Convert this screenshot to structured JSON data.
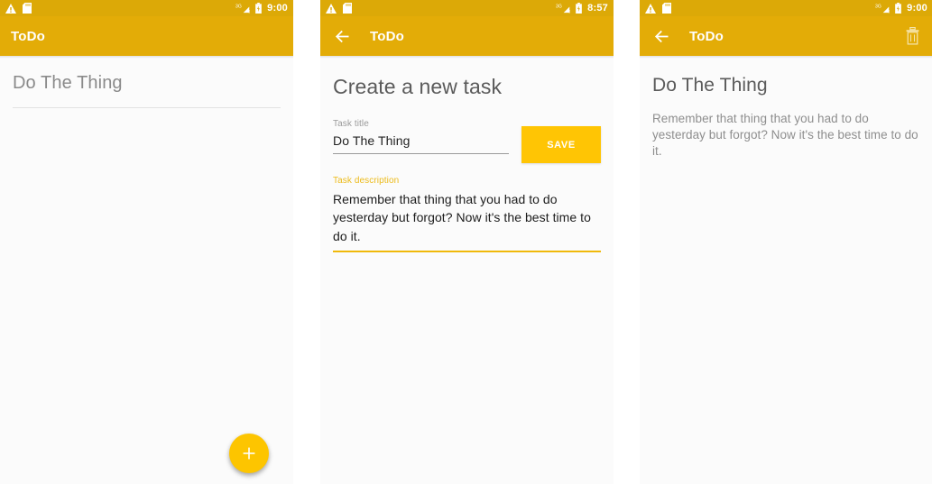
{
  "app": {
    "name": "ToDo",
    "colors": {
      "status_bar": "#dca907",
      "app_bar": "#e3ac07",
      "accent": "#ffc504",
      "fab": "#fdc500",
      "focused_label": "#ecbb1b"
    }
  },
  "screens": [
    {
      "id": "task-list",
      "status_bar": {
        "time": "9:00",
        "icons_left": [
          "warning-icon",
          "sd-card-icon"
        ],
        "icons_right": [
          "signal-3g-icon",
          "battery-icon"
        ]
      },
      "app_bar": {
        "title": "ToDo",
        "has_back": false,
        "has_delete": false
      },
      "list": {
        "items": [
          {
            "title": "Do The Thing"
          }
        ]
      },
      "fab": {
        "icon": "plus-icon",
        "label": "+"
      }
    },
    {
      "id": "create-task",
      "status_bar": {
        "time": "8:57",
        "icons_left": [
          "warning-icon",
          "sd-card-icon"
        ],
        "icons_right": [
          "signal-3g-icon",
          "battery-icon"
        ]
      },
      "app_bar": {
        "title": "ToDo",
        "has_back": true,
        "has_delete": false
      },
      "heading": "Create a new task",
      "fields": {
        "title": {
          "label": "Task title",
          "value": "Do The Thing",
          "placeholder": "Task title",
          "focused": false
        },
        "description": {
          "label": "Task description",
          "value": "Remember that thing that you had to do yesterday but forgot? Now it's the best time to do it.",
          "placeholder": "Task description",
          "focused": true
        }
      },
      "save_button": "SAVE"
    },
    {
      "id": "task-detail",
      "status_bar": {
        "time": "9:00",
        "icons_left": [
          "warning-icon",
          "sd-card-icon"
        ],
        "icons_right": [
          "signal-3g-icon",
          "battery-icon"
        ]
      },
      "app_bar": {
        "title": "ToDo",
        "has_back": true,
        "has_delete": true,
        "delete_icon": "trash-icon"
      },
      "task": {
        "title": "Do The Thing",
        "description": "Remember that thing that you had to do yesterday but forgot? Now it's the best time to do it."
      }
    }
  ]
}
